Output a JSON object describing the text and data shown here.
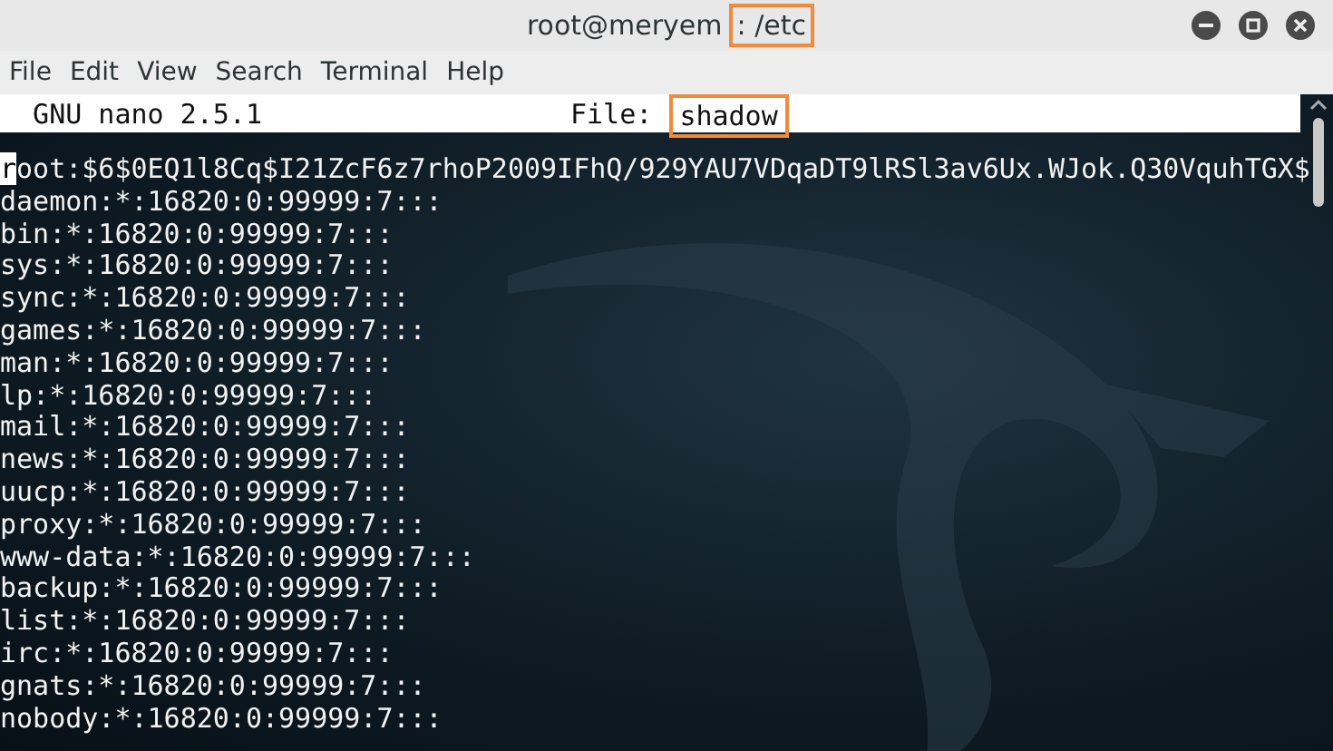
{
  "window": {
    "title_parts": [
      {
        "text": "root@meryem",
        "highlighted": false
      },
      {
        "text": ": /etc",
        "highlighted": true
      }
    ]
  },
  "menu": [
    "File",
    "Edit",
    "View",
    "Search",
    "Terminal",
    "Help"
  ],
  "nano_header": {
    "version": "GNU nano 2.5.1",
    "file_label": "File:",
    "file_name": "shadow",
    "file_highlighted": true
  },
  "lines": [
    {
      "text": "root:$6$0EQ1l8Cq$I21ZcF6z7rhoP2009IFhQ/929YAU7VDqaDT9lRSl3av6Ux.WJok.Q30VquhTGX$",
      "cursor": true
    },
    {
      "text": "daemon:*:16820:0:99999:7:::",
      "cursor": false
    },
    {
      "text": "bin:*:16820:0:99999:7:::",
      "cursor": false
    },
    {
      "text": "sys:*:16820:0:99999:7:::",
      "cursor": false
    },
    {
      "text": "sync:*:16820:0:99999:7:::",
      "cursor": false
    },
    {
      "text": "games:*:16820:0:99999:7:::",
      "cursor": false
    },
    {
      "text": "man:*:16820:0:99999:7:::",
      "cursor": false
    },
    {
      "text": "lp:*:16820:0:99999:7:::",
      "cursor": false
    },
    {
      "text": "mail:*:16820:0:99999:7:::",
      "cursor": false
    },
    {
      "text": "news:*:16820:0:99999:7:::",
      "cursor": false
    },
    {
      "text": "uucp:*:16820:0:99999:7:::",
      "cursor": false
    },
    {
      "text": "proxy:*:16820:0:99999:7:::",
      "cursor": false
    },
    {
      "text": "www-data:*:16820:0:99999:7:::",
      "cursor": false
    },
    {
      "text": "backup:*:16820:0:99999:7:::",
      "cursor": false
    },
    {
      "text": "list:*:16820:0:99999:7:::",
      "cursor": false
    },
    {
      "text": "irc:*:16820:0:99999:7:::",
      "cursor": false
    },
    {
      "text": "gnats:*:16820:0:99999:7:::",
      "cursor": false
    },
    {
      "text": "nobody:*:16820:0:99999:7:::",
      "cursor": false
    }
  ]
}
